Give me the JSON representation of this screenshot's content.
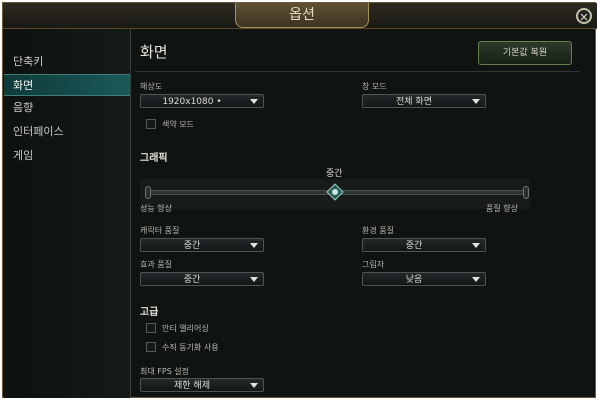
{
  "window": {
    "title": "옵션",
    "close_symbol": "✕"
  },
  "sidebar": {
    "items": [
      {
        "label": "단축키",
        "active": false
      },
      {
        "label": "화면",
        "active": true
      },
      {
        "label": "음향",
        "active": false
      },
      {
        "label": "인터페이스",
        "active": false
      },
      {
        "label": "게임",
        "active": false
      }
    ]
  },
  "display": {
    "title": "화면",
    "reset_label": "기본값 복원",
    "resolution": {
      "label": "해상도",
      "value": "1920x1080 •"
    },
    "window_mode": {
      "label": "창 모드",
      "value": "전체 화면"
    },
    "colorblind": {
      "label": "색약 모드",
      "checked": false
    }
  },
  "graphics": {
    "title": "그래픽",
    "level_label": "중간",
    "slider_left_label": "성능 향상",
    "slider_right_label": "품질 향상",
    "slider_position": 0.5,
    "character_quality": {
      "label": "캐릭터 품질",
      "value": "중간"
    },
    "environment_quality": {
      "label": "환경 품질",
      "value": "중간"
    },
    "effects_quality": {
      "label": "효과 품질",
      "value": "중간"
    },
    "shadows": {
      "label": "그림자",
      "value": "낮음"
    }
  },
  "advanced": {
    "title": "고급",
    "antialiasing": {
      "label": "안티 앨리어싱",
      "checked": false
    },
    "vsync": {
      "label": "수직 동기화 사용",
      "checked": false
    },
    "fps_cap": {
      "label": "최대 FPS 설정",
      "value": "제한 해제"
    }
  },
  "colors": {
    "accent": "#1a5a58",
    "panel": "#0f1413",
    "border_gold": "#a8905a"
  }
}
